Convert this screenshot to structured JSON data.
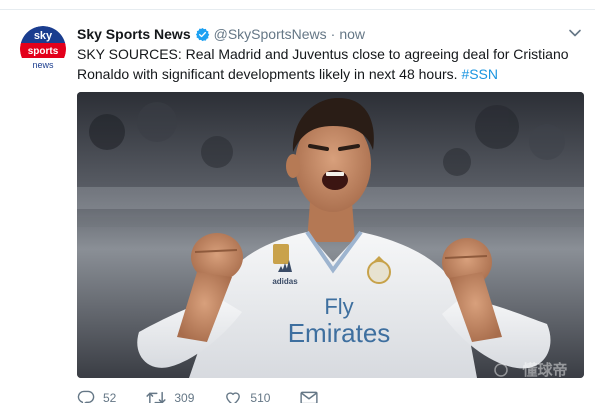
{
  "tweet": {
    "display_name": "Sky Sports News",
    "handle": "@SkySportsNews",
    "separator": "·",
    "time": "now",
    "text": "SKY SOURCES: Real Madrid and Juventus close to agreeing deal for Cristiano Ronaldo with significant developments likely in next 48 hours.",
    "hashtag": "#SSN",
    "avatar_logo": [
      "sky",
      "sports",
      "news"
    ],
    "shirt_sponsor": [
      "Fly",
      "Emirates"
    ],
    "shirt_brand": "adidas",
    "watermark": "懂球帝"
  },
  "actions": {
    "reply_icon": "reply-icon",
    "reply_count": "52",
    "retweet_icon": "retweet-icon",
    "retweet_count": "309",
    "like_icon": "heart-icon",
    "like_count": "510",
    "dm_icon": "envelope-icon"
  },
  "colors": {
    "link": "#1b95e0",
    "muted": "#657786",
    "verified": "#1da1f2",
    "sky_red": "#e3001b",
    "sky_blue": "#1a3d8f"
  }
}
